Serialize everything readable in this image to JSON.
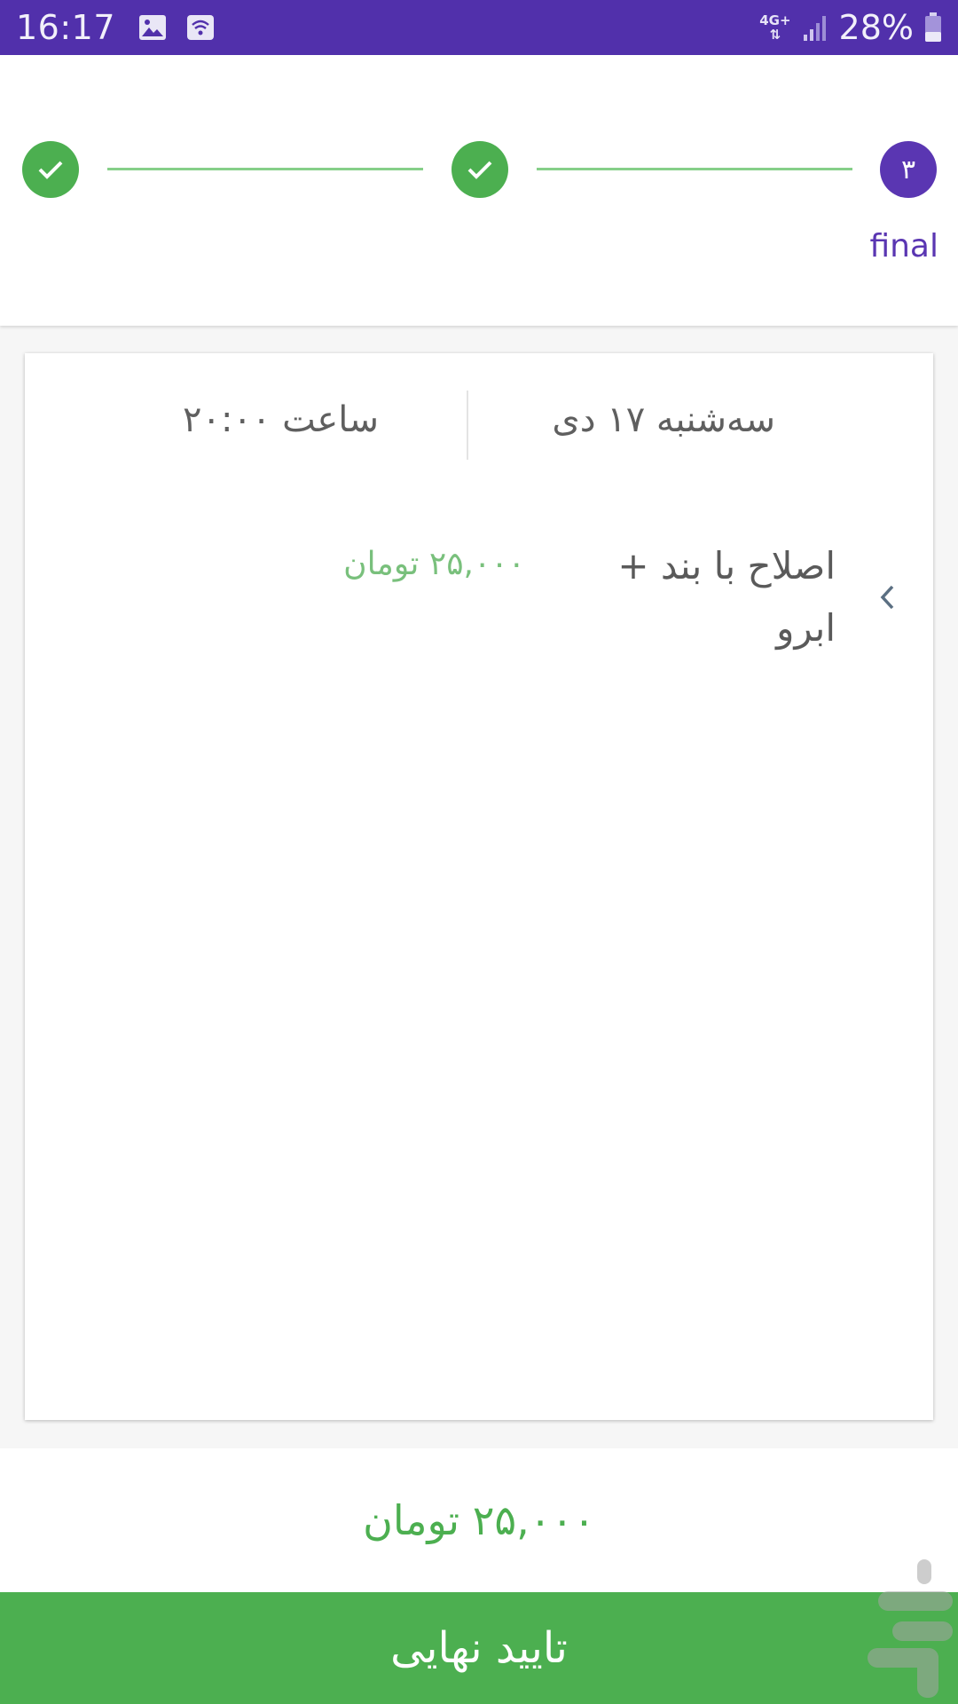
{
  "status_bar": {
    "time": "16:17",
    "network_type": "4G+",
    "battery_percent": "28%",
    "icons": [
      "image-icon",
      "wifi-call-icon",
      "signal-icon",
      "battery-icon"
    ]
  },
  "stepper": {
    "steps": [
      {
        "state": "done",
        "icon": "check-icon"
      },
      {
        "state": "done",
        "icon": "check-icon"
      },
      {
        "state": "active",
        "number": "۳"
      }
    ],
    "active_label": "final",
    "colors": {
      "done": "#4caf50",
      "active": "#5a36b2",
      "line": "#86cf89"
    }
  },
  "booking": {
    "date": "سه‌شنبه ۱۷ دی",
    "time": "ساعت ۲۰:۰۰",
    "services": [
      {
        "name": "اصلاح با بند + ابرو",
        "price": "۲۵,۰۰۰ تومان"
      }
    ]
  },
  "total": {
    "amount": "۲۵,۰۰۰ تومان"
  },
  "confirm_button": {
    "label": "تایید نهایی",
    "color": "#4caf50"
  },
  "colors": {
    "status_bar": "#5130ab",
    "accent_green": "#4caf50",
    "price_green": "#79c07c"
  }
}
